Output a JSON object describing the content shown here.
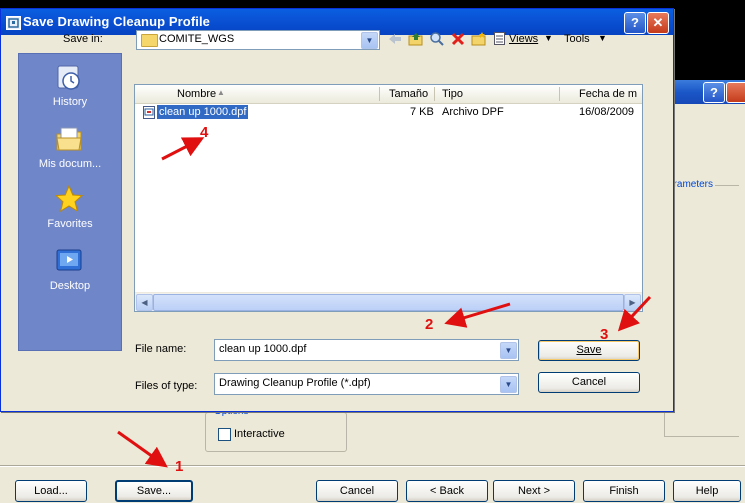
{
  "background_window": {
    "group_label": "arameters",
    "options": {
      "label": "Options",
      "interactive_label": "Interactive",
      "interactive_checked": false
    },
    "buttons": {
      "load": "Load...",
      "save": "Save...",
      "cancel": "Cancel",
      "back": "< Back",
      "next": "Next >",
      "finish": "Finish",
      "help": "Help"
    }
  },
  "dialog": {
    "title": "Save Drawing Cleanup Profile",
    "help_glyph": "?",
    "close_glyph": "✕",
    "save_in_label": "Save in:",
    "save_in_value": "COMITE_WGS",
    "toolbar": {
      "views": "Views",
      "tools": "Tools"
    },
    "places": [
      {
        "label": "History",
        "icon": "history-icon"
      },
      {
        "label": "Mis docum...",
        "icon": "documents-icon"
      },
      {
        "label": "Favorites",
        "icon": "favorites-icon"
      },
      {
        "label": "Desktop",
        "icon": "desktop-icon"
      }
    ],
    "columns": {
      "name": "Nombre",
      "size": "Tamaño",
      "type": "Tipo",
      "date": "Fecha de m"
    },
    "files": [
      {
        "name": "clean up 1000.dpf",
        "size": "7 KB",
        "type": "Archivo DPF",
        "date": "16/08/2009",
        "selected": true
      }
    ],
    "file_name_label": "File name:",
    "file_name_value": "clean up 1000.dpf",
    "files_of_type_label": "Files of type:",
    "files_of_type_value": "Drawing Cleanup Profile (*.dpf)",
    "save_button": "Save",
    "cancel_button": "Cancel"
  },
  "annotations": [
    "1",
    "2",
    "3",
    "4"
  ],
  "colors": {
    "arrow": "#e01010",
    "title_bar": "#0a52d6",
    "places_bar": "#6f86c9",
    "selection": "#316ac5"
  }
}
